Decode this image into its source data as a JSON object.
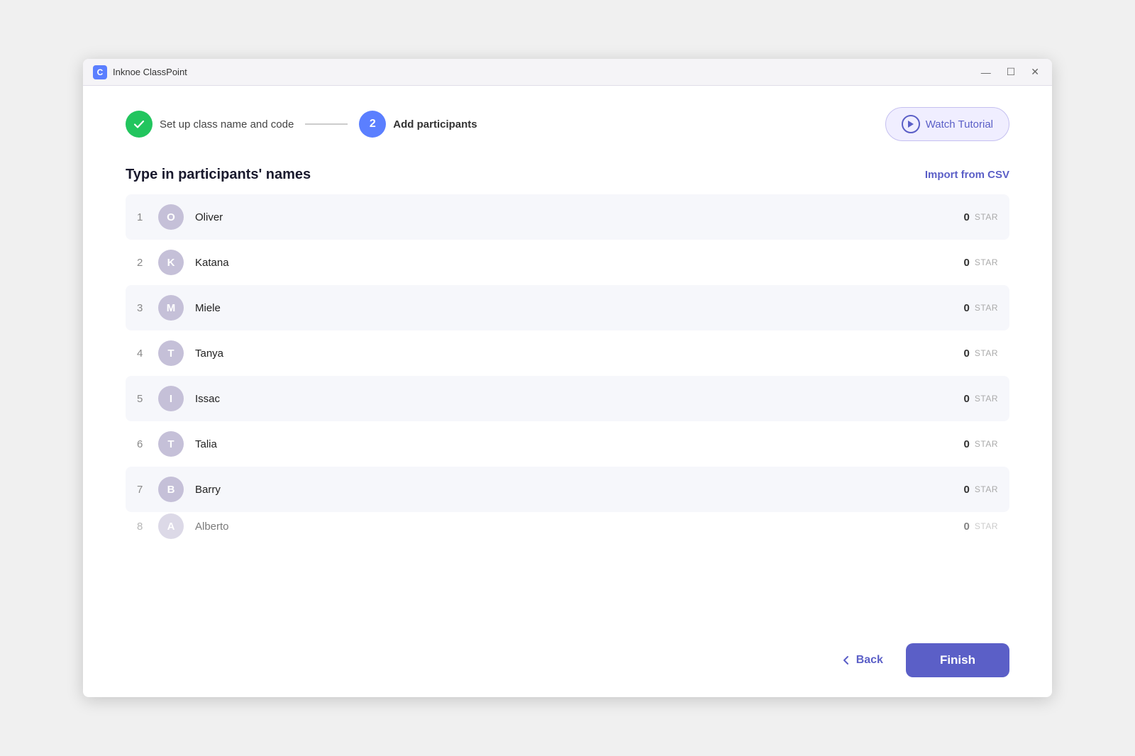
{
  "window": {
    "title": "Inknoe ClassPoint",
    "logo_letter": "C",
    "controls": {
      "minimize": "—",
      "maximize": "☐",
      "close": "✕"
    }
  },
  "stepper": {
    "step1": {
      "label": "Set up class name and code",
      "done": true
    },
    "step2": {
      "number": "2",
      "label": "Add participants",
      "active": true
    },
    "watch_tutorial_label": "Watch Tutorial"
  },
  "section": {
    "title": "Type in participants' names",
    "import_csv_label": "Import from CSV"
  },
  "participants": [
    {
      "number": 1,
      "initial": "O",
      "name": "Oliver",
      "stars": 0
    },
    {
      "number": 2,
      "initial": "K",
      "name": "Katana",
      "stars": 0
    },
    {
      "number": 3,
      "initial": "M",
      "name": "Miele",
      "stars": 0
    },
    {
      "number": 4,
      "initial": "T",
      "name": "Tanya",
      "stars": 0
    },
    {
      "number": 5,
      "initial": "I",
      "name": "Issac",
      "stars": 0
    },
    {
      "number": 6,
      "initial": "T",
      "name": "Talia",
      "stars": 0
    },
    {
      "number": 7,
      "initial": "B",
      "name": "Barry",
      "stars": 0
    },
    {
      "number": 8,
      "initial": "A",
      "name": "Alberto",
      "stars": 0,
      "partial": true
    }
  ],
  "footer": {
    "back_label": "Back",
    "finish_label": "Finish"
  },
  "colors": {
    "accent": "#5b5fc7",
    "green": "#22c55e",
    "avatar_bg": "#c5c0d8"
  }
}
